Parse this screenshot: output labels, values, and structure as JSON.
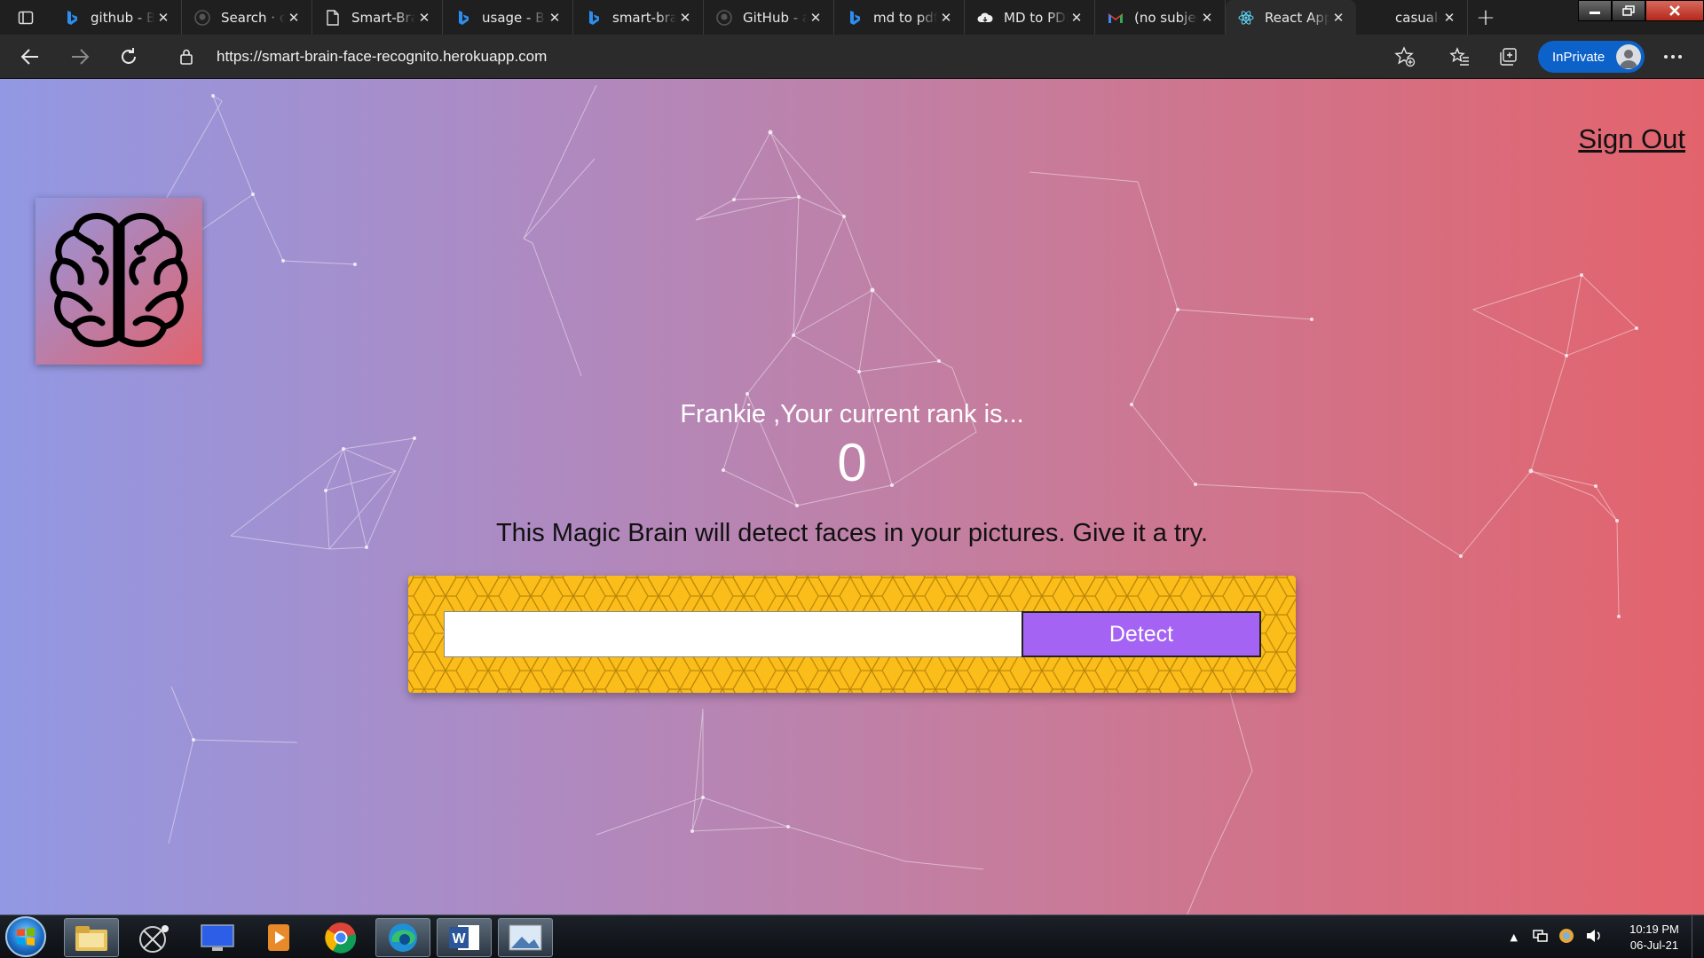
{
  "browser": {
    "tabs": [
      {
        "title": "github - Bing",
        "favicon": "bing-icon",
        "active": false
      },
      {
        "title": "Search · code",
        "favicon": "github-icon",
        "active": false
      },
      {
        "title": "Smart-Brain",
        "favicon": "page-icon",
        "active": false
      },
      {
        "title": "usage - Bing",
        "favicon": "bing-icon",
        "active": false
      },
      {
        "title": "smart-brain",
        "favicon": "bing-icon",
        "active": false
      },
      {
        "title": "GitHub - a",
        "favicon": "github-icon",
        "active": false
      },
      {
        "title": "md to pdf",
        "favicon": "bing-icon",
        "active": false
      },
      {
        "title": "MD to PDF",
        "favicon": "cloud-icon",
        "active": false
      },
      {
        "title": "(no subject)",
        "favicon": "gmail-icon",
        "active": false
      },
      {
        "title": "React App",
        "favicon": "react-icon",
        "active": true
      },
      {
        "title": "casual-ma",
        "favicon": "",
        "active": false
      }
    ],
    "address": {
      "url": "https://smart-brain-face-recognito.herokuapp.com"
    },
    "inprivate_label": "InPrivate"
  },
  "page": {
    "signout_label": "Sign Out",
    "rank": {
      "label": "Frankie ,Your current rank is...",
      "value": "0"
    },
    "tagline": "This Magic Brain will detect faces in your pictures. Give it a try.",
    "form": {
      "input_value": "",
      "button_label": "Detect"
    },
    "colors": {
      "bg_start": "#9298e3",
      "bg_end": "#e3636c",
      "form_bg": "#fbbd19",
      "button_bg": "#a463f2"
    }
  },
  "taskbar": {
    "apps": [
      "windows-explorer-icon",
      "media-icon",
      "monitor-icon",
      "video-player-icon",
      "chrome-icon",
      "edge-icon",
      "word-icon",
      "photos-icon"
    ],
    "clock": {
      "time": "10:19 PM",
      "date": "06-Jul-21"
    }
  }
}
